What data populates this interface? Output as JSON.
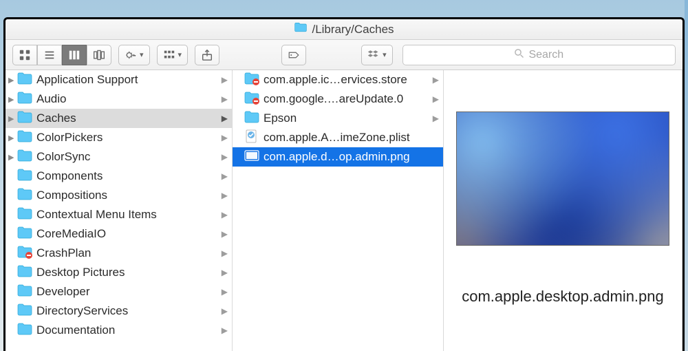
{
  "title": "/Library/Caches",
  "search_placeholder": "Search",
  "col1": [
    {
      "name": "Application Support",
      "type": "folder",
      "hasParent": true
    },
    {
      "name": "Audio",
      "type": "folder",
      "hasParent": true
    },
    {
      "name": "Caches",
      "type": "folder",
      "hasParent": true,
      "selected": true
    },
    {
      "name": "ColorPickers",
      "type": "folder",
      "hasParent": true
    },
    {
      "name": "ColorSync",
      "type": "folder",
      "hasParent": true
    },
    {
      "name": "Components",
      "type": "folder",
      "hasParent": false
    },
    {
      "name": "Compositions",
      "type": "folder",
      "hasParent": false
    },
    {
      "name": "Contextual Menu Items",
      "type": "folder",
      "hasParent": false
    },
    {
      "name": "CoreMediaIO",
      "type": "folder",
      "hasParent": false
    },
    {
      "name": "CrashPlan",
      "type": "folder-restricted",
      "hasParent": false
    },
    {
      "name": "Desktop Pictures",
      "type": "folder",
      "hasParent": false
    },
    {
      "name": "Developer",
      "type": "folder",
      "hasParent": false
    },
    {
      "name": "DirectoryServices",
      "type": "folder",
      "hasParent": false
    },
    {
      "name": "Documentation",
      "type": "folder",
      "hasParent": false
    }
  ],
  "col2": [
    {
      "name": "com.apple.ic…ervices.store",
      "type": "folder-restricted"
    },
    {
      "name": "com.google.…areUpdate.0",
      "type": "folder-restricted"
    },
    {
      "name": "Epson",
      "type": "folder",
      "expandable": true
    },
    {
      "name": "com.apple.A…imeZone.plist",
      "type": "plist"
    },
    {
      "name": "com.apple.d…op.admin.png",
      "type": "png",
      "selected": true
    }
  ],
  "preview": {
    "filename": "com.apple.desktop.admin.png"
  },
  "colors": {
    "selection_blue": "#1473e6",
    "folder_blue": "#5ec9f7"
  }
}
